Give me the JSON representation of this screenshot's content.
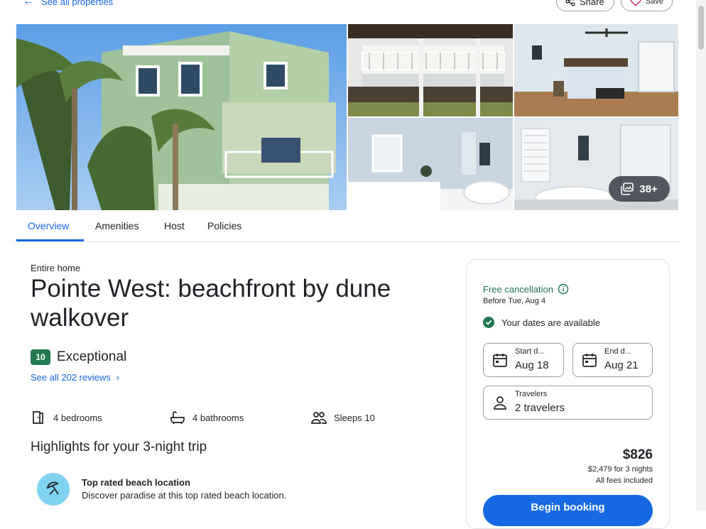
{
  "header": {
    "back_label": "See all properties",
    "share_label": "Share",
    "save_label": "Save"
  },
  "gallery": {
    "photos": [
      "house-exterior",
      "balcony",
      "bedroom",
      "bathroom",
      "bathroom-tub"
    ],
    "more_count": "38+"
  },
  "tabs": [
    {
      "label": "Overview",
      "active": true
    },
    {
      "label": "Amenities",
      "active": false
    },
    {
      "label": "Host",
      "active": false
    },
    {
      "label": "Policies",
      "active": false
    }
  ],
  "overview": {
    "property_type": "Entire home",
    "title": "Pointe West: beachfront by dune walkover",
    "score": "10",
    "score_label": "Exceptional",
    "reviews_link": "See all 202 reviews",
    "features": [
      {
        "icon": "door-icon",
        "label": "4 bedrooms"
      },
      {
        "icon": "bathtub-icon",
        "label": "4 bathrooms"
      },
      {
        "icon": "people-icon",
        "label": "Sleeps 10"
      }
    ],
    "highlights_heading": "Highlights for your 3-night trip",
    "highlight": {
      "icon": "beach-umbrella-icon",
      "title": "Top rated beach location",
      "description": "Discover paradise at this top rated beach location."
    }
  },
  "booking": {
    "free_cancellation": "Free cancellation",
    "cancel_before": "Before Tue, Aug 4",
    "availability": "Your dates are available",
    "start_label": "Start d...",
    "start_value": "Aug 18",
    "end_label": "End d...",
    "end_value": "Aug 21",
    "travelers_label": "Travelers",
    "travelers_value": "2 travelers",
    "price": "$826",
    "price_total": "$2,479 for 3 nights",
    "fees": "All fees included",
    "cta": "Begin booking"
  },
  "colors": {
    "accent": "#1668e3",
    "positive": "#227950",
    "highlight_icon_bg": "#7fd3f0"
  }
}
